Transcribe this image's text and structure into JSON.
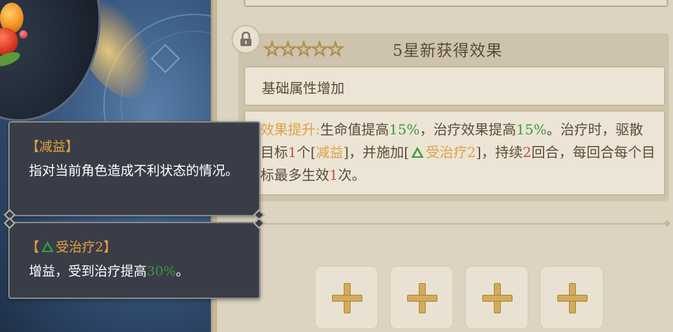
{
  "section": {
    "lock_icon": "lock-icon",
    "stars": [
      "☆",
      "☆",
      "☆",
      "☆",
      "☆"
    ],
    "star_count": 5,
    "title": "5星新获得效果"
  },
  "basic": {
    "label": "基础属性增加"
  },
  "effect": {
    "prefix": "效果提升:",
    "t1": "生命值提高",
    "v1": "15%",
    "t2": "，治疗效果提高",
    "v2": "15%",
    "t3": "。治疗时，驱散目标",
    "n1": "1",
    "t4": "个[",
    "debuff": "减益",
    "t5": "]，并施加[",
    "buff": "受治疗2",
    "t6": "]，持续",
    "n2": "2",
    "t7": "回合，每回合每个目标最多生效",
    "n3": "1",
    "t8": "次。"
  },
  "slots": {
    "count": 4,
    "icon": "plus-icon"
  },
  "tooltips": [
    {
      "head": "【减益】",
      "body": "指对当前角色造成不利状态的情况。"
    },
    {
      "head_open": "【",
      "head_name": "受治疗2",
      "head_close": "】",
      "body_prefix": "增益，受到治疗提高",
      "body_value": "30%",
      "body_suffix": "。"
    }
  ],
  "colors": {
    "highlight_orange": "#e0a04a",
    "value_green": "#3d9a3c",
    "number_red": "#c05040",
    "tooltip_bg": "#393d48"
  }
}
